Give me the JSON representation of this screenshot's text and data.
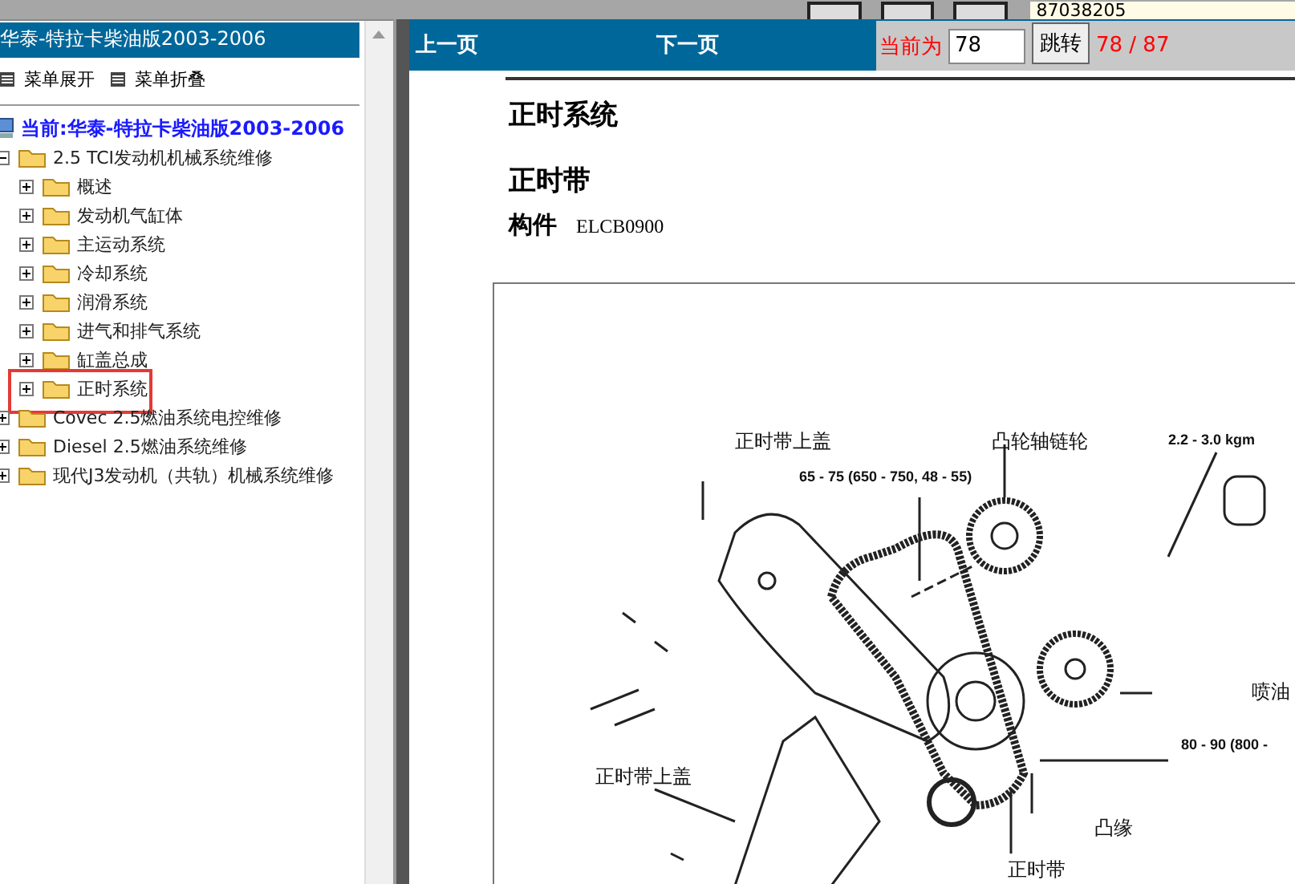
{
  "top_bar": {
    "number": "87038205"
  },
  "sidebar": {
    "title": "华泰-特拉卡柴油版2003-2006",
    "actions": [
      "菜单展开",
      "菜单折叠"
    ],
    "tree": {
      "label": "当前:华泰-特拉卡柴油版2003-2006",
      "children": [
        {
          "label": "2.5 TCI发动机机械系统维修",
          "expanded": true,
          "children": [
            {
              "label": "概述",
              "expanded": false,
              "highlighted": false
            },
            {
              "label": "发动机气缸体",
              "expanded": false,
              "highlighted": false
            },
            {
              "label": "主运动系统",
              "expanded": false,
              "highlighted": false
            },
            {
              "label": "冷却系统",
              "expanded": false,
              "highlighted": false
            },
            {
              "label": "润滑系统",
              "expanded": false,
              "highlighted": false
            },
            {
              "label": "进气和排气系统",
              "expanded": false,
              "highlighted": false
            },
            {
              "label": "缸盖总成",
              "expanded": false,
              "highlighted": false
            },
            {
              "label": "正时系统",
              "expanded": false,
              "highlighted": true
            }
          ]
        },
        {
          "label": "Covec 2.5燃油系统电控维修",
          "expanded": false
        },
        {
          "label": "Diesel 2.5燃油系统维修",
          "expanded": false
        },
        {
          "label": "现代J3发动机（共轨）机械系统维修",
          "expanded": false
        }
      ]
    }
  },
  "nav": {
    "prev": "上一页",
    "next": "下一页",
    "current_label": "当前为",
    "page_value": "78",
    "jump": "跳转",
    "page_count": "78 / 87"
  },
  "document": {
    "section": "正时系统",
    "heading": "正时带",
    "component_label": "构件",
    "component_code": "ELCB0900",
    "callouts": [
      "正时带上盖",
      "凸轮轴链轮",
      "2.2 - 3.0 kgm",
      "65 - 75 (650 - 750, 48 - 55)",
      "喷油",
      "80 - 90 (800 -",
      "正时带上盖",
      "凸缘",
      "正时带"
    ]
  }
}
